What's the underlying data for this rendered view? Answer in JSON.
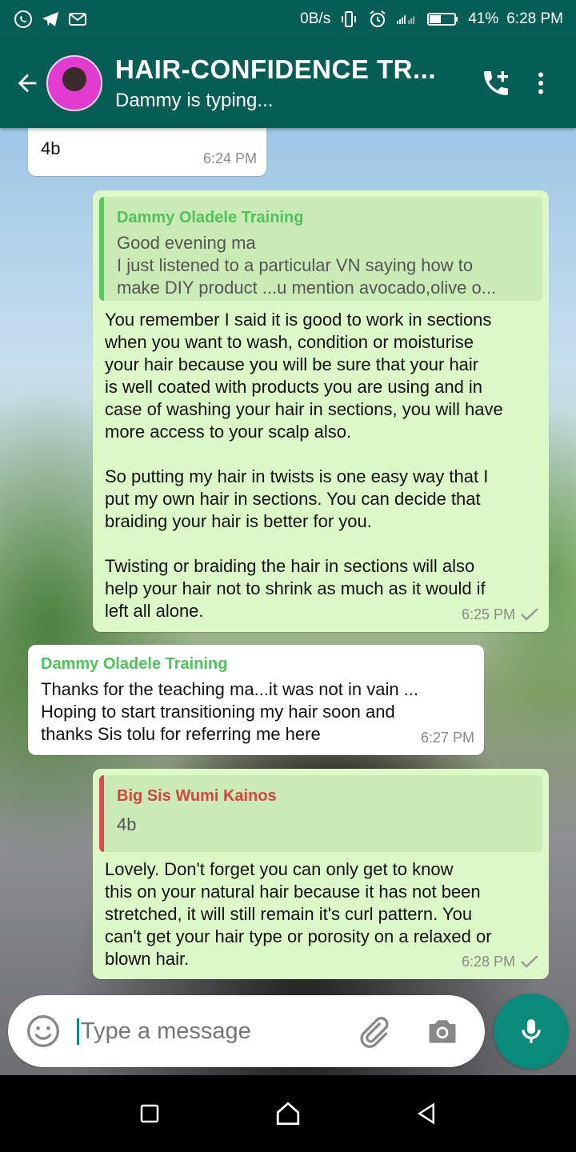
{
  "status_bar": {
    "network_speed": "0B/s",
    "battery": "41%",
    "time": "6:28 PM"
  },
  "header": {
    "title": "HAIR-CONFIDENCE TR...",
    "subtitle": "Dammy is typing..."
  },
  "messages": [
    {
      "id": "m0",
      "direction": "in",
      "text": "4b",
      "time": "6:24 PM"
    },
    {
      "id": "m1",
      "direction": "out",
      "quote": {
        "author": "Dammy Oladele Training",
        "lines": [
          "Good evening ma",
          "I just listened to a particular VN saying how to",
          "make DIY product ...u mention avocado,olive o..."
        ]
      },
      "text": "You remember I said it is good to work in sections\nwhen you want to wash, condition or moisturise\nyour hair because you will be sure that your hair\nis well coated with products you are using and in\ncase of washing your hair in sections, you will have\nmore access to your scalp also.\n\nSo putting my hair in twists is one easy way that I\nput my own hair in sections. You can decide that\nbraiding your hair is better for you.\n\nTwisting or braiding the hair in sections will also\nhelp your hair not to shrink as much as it would if\nleft all alone.",
      "time": "6:25 PM"
    },
    {
      "id": "m2",
      "direction": "in",
      "sender": "Dammy Oladele Training",
      "text": "Thanks for the teaching ma...it was not in vain ...\nHoping to start transitioning my hair soon and\nthanks Sis tolu for referring me here",
      "time": "6:27 PM"
    },
    {
      "id": "m3",
      "direction": "out",
      "quote": {
        "author": "Big Sis Wumi Kainos",
        "lines": [
          "4b"
        ]
      },
      "text": "Lovely. Don't forget you can only get to know\nthis on your natural hair because it has not been\nstretched, it will still remain it's curl pattern. You\ncan't get your hair type or porosity on a relaxed or\nblown hair.",
      "time": "6:28 PM"
    }
  ],
  "composer": {
    "placeholder": "Type a message"
  },
  "colors": {
    "header": "#075e54",
    "outgoing_bubble": "#dcf8c6",
    "incoming_bubble": "#ffffff",
    "accent": "#0a8a7a",
    "quote_green": "#4ec35a",
    "quote_red": "#d5443f"
  },
  "icons": {
    "status_left": [
      "whatsapp-icon",
      "telegram-icon",
      "gmail-icon"
    ],
    "status_right": [
      "vibrate-icon",
      "alarm-icon",
      "signal-icon",
      "battery-icon"
    ],
    "header": [
      "back-arrow-icon",
      "add-call-icon",
      "more-vert-icon"
    ],
    "composer": [
      "emoji-icon",
      "attach-icon",
      "camera-icon",
      "mic-icon"
    ],
    "navbar": [
      "recents-icon",
      "home-icon",
      "back-icon"
    ]
  }
}
